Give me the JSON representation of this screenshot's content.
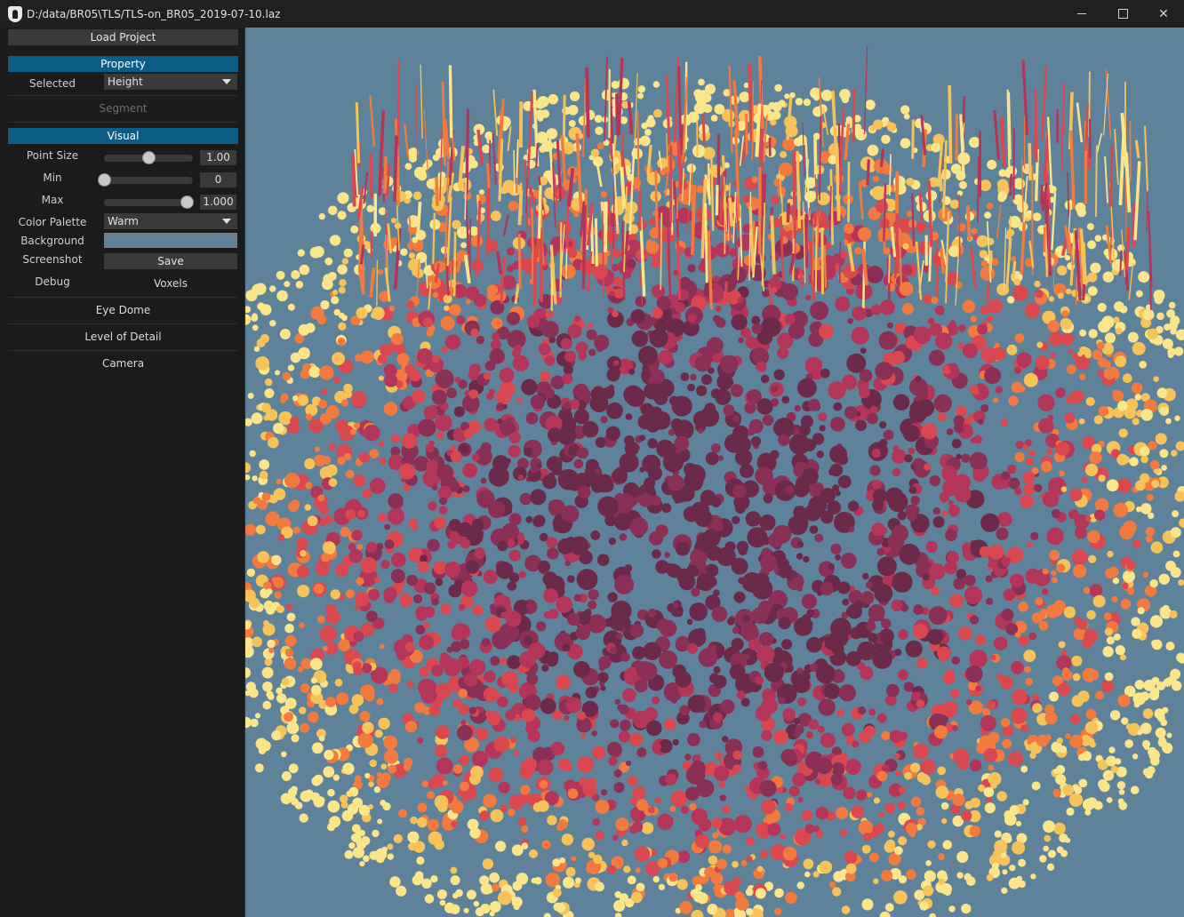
{
  "window": {
    "title": "D:/data/BR05\\TLS/TLS-on_BR05_2019-07-10.laz",
    "controls": [
      "minimize",
      "maximize",
      "close"
    ]
  },
  "sidebar": {
    "load_project_label": "Load Project",
    "property": {
      "header": "Property",
      "selected_label": "Selected",
      "selected_value": "Height"
    },
    "segment_label": "Segment",
    "visual": {
      "header": "Visual",
      "point_size": {
        "label": "Point Size",
        "value": "1.00",
        "fraction": 0.5
      },
      "min": {
        "label": "Min",
        "value": "0",
        "fraction": 0.0
      },
      "max": {
        "label": "Max",
        "value": "1.000",
        "fraction": 0.93
      },
      "color_palette": {
        "label": "Color Palette",
        "value": "Warm"
      },
      "background": {
        "label": "Background",
        "color": "#5e8299"
      },
      "screenshot": {
        "label": "Screenshot",
        "button": "Save"
      },
      "debug": {
        "label": "Debug",
        "value": "Voxels"
      }
    },
    "eye_dome_label": "Eye Dome",
    "level_of_detail_label": "Level of Detail",
    "camera_label": "Camera"
  },
  "viewport": {
    "background_color": "#5e8299",
    "palette": [
      "#6b2a4a",
      "#8a2f55",
      "#b3365a",
      "#d9474f",
      "#f07a40",
      "#f6c25a",
      "#fbe58a"
    ]
  },
  "colors": {
    "accent": "#0b5c86",
    "panel": "#1b1b1b",
    "widget": "#3a3a3a"
  }
}
